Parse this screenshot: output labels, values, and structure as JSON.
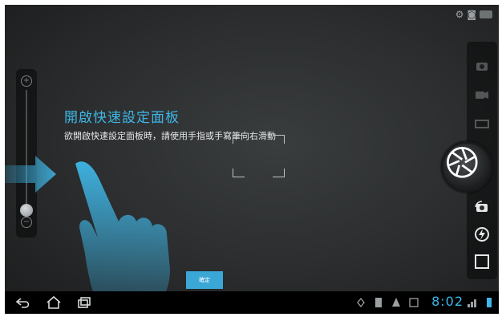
{
  "overlay": {
    "title": "開啟快速設定面板",
    "subtitle": "欲開啟快速設定面板時，請使用手指或手寫筆向右滑動",
    "ok_label": "確定"
  },
  "status": {
    "time": "8:02"
  },
  "icons": {
    "top": [
      "camera-mode-icon",
      "screenshot-icon",
      "status-indicator-icon"
    ],
    "zoom": [
      "zoom-in-icon",
      "zoom-out-icon"
    ],
    "right_panel": [
      "photo-mode-icon",
      "video-mode-icon",
      "panorama-mode-icon",
      "switch-camera-icon",
      "flash-auto-icon",
      "settings-square-icon"
    ],
    "nav": [
      "back-icon",
      "home-icon",
      "recent-apps-icon"
    ],
    "tray": [
      "gps-icon",
      "document-icon",
      "warning-icon",
      "gallery-icon",
      "wifi-icon",
      "battery-icon"
    ]
  },
  "colors": {
    "accent": "#3fb7e8",
    "button": "#3aa7d6",
    "navbar": "#000000"
  }
}
